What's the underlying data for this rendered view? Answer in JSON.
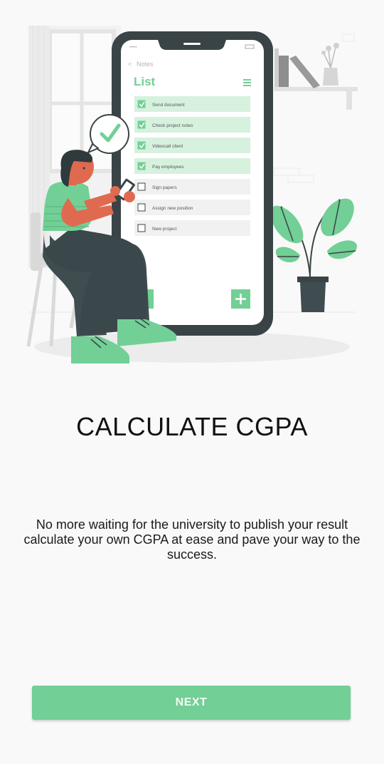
{
  "onboarding": {
    "title": "CALCULATE CGPA",
    "description": "No more waiting for the university to publish your result calculate your own CGPA at ease and pave your way to the success.",
    "next_label": "NEXT"
  },
  "illustration": {
    "back_label": "Notes",
    "list_title": "List",
    "items": [
      {
        "label": "Send document",
        "checked": true
      },
      {
        "label": "Check project notes",
        "checked": true
      },
      {
        "label": "Videocall client",
        "checked": true
      },
      {
        "label": "Pay employees",
        "checked": true
      },
      {
        "label": "Sign papers",
        "checked": false
      },
      {
        "label": "Assign new position",
        "checked": false
      },
      {
        "label": "New project",
        "checked": false
      }
    ]
  },
  "colors": {
    "accent": "#72cf96",
    "phone_frame": "#3a4446",
    "skin": "#e06a4f",
    "pants": "#3f4c50"
  }
}
